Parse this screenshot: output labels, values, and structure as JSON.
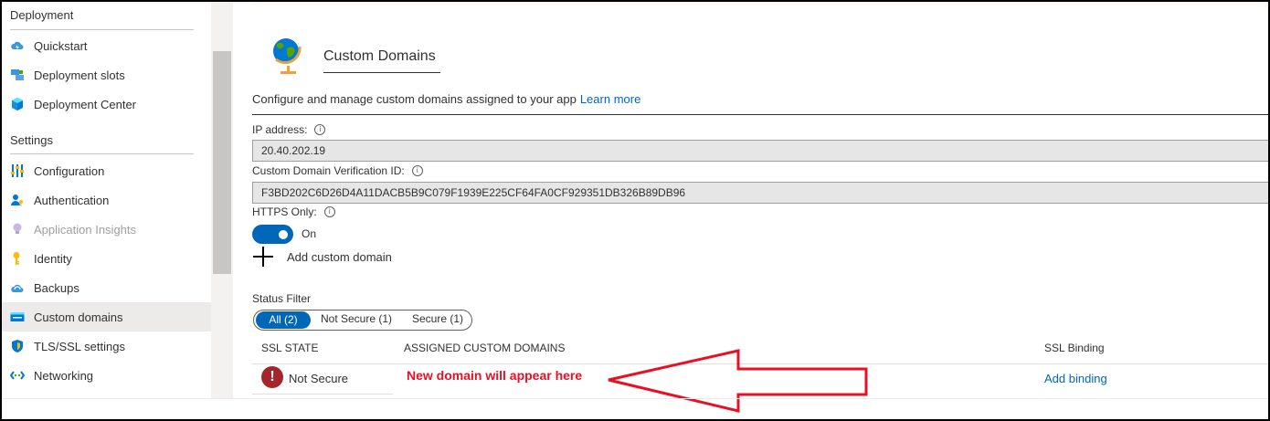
{
  "sidebar": {
    "deployment_title": "Deployment",
    "deployment_items": [
      {
        "label": "Quickstart",
        "icon": "cloud-lightning-icon"
      },
      {
        "label": "Deployment slots",
        "icon": "slots-icon"
      },
      {
        "label": "Deployment Center",
        "icon": "cube-icon"
      }
    ],
    "settings_title": "Settings",
    "settings_items": [
      {
        "label": "Configuration",
        "icon": "sliders-icon"
      },
      {
        "label": "Authentication",
        "icon": "user-key-icon"
      },
      {
        "label": "Application Insights",
        "icon": "lightbulb-icon",
        "disabled": true
      },
      {
        "label": "Identity",
        "icon": "key-icon"
      },
      {
        "label": "Backups",
        "icon": "cloud-backup-icon"
      },
      {
        "label": "Custom domains",
        "icon": "www-icon",
        "active": true
      },
      {
        "label": "TLS/SSL settings",
        "icon": "shield-icon"
      },
      {
        "label": "Networking",
        "icon": "network-icon"
      }
    ]
  },
  "main": {
    "title": "Custom Domains",
    "description": "Configure and manage custom domains assigned to your app",
    "learn_more": "Learn more",
    "ip_label": "IP address:",
    "ip_value": "20.40.202.19",
    "verification_label": "Custom Domain Verification ID:",
    "verification_value": "F3BD202C6D26D4A11DACB5B9C079F1939E225CF64FA0CF929351DB326B89DB96",
    "https_label": "HTTPS Only:",
    "https_state": "On",
    "add_domain": "Add custom domain",
    "status_filter_label": "Status Filter",
    "filters": [
      "All (2)",
      "Not Secure (1)",
      "Secure (1)"
    ],
    "columns": [
      "SSL STATE",
      "ASSIGNED CUSTOM DOMAINS",
      "SSL Binding"
    ],
    "row": {
      "ssl_state": "Not Secure",
      "binding": "Add binding"
    },
    "annotation": "New domain will appear here"
  },
  "colors": {
    "accent": "#0067b8",
    "error": "#a4262c",
    "annotation": "#e81123"
  }
}
